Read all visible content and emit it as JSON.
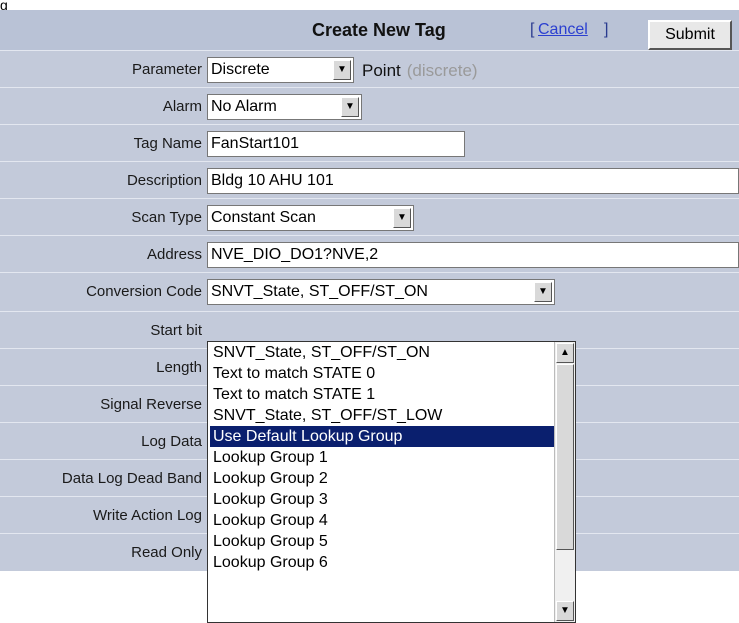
{
  "page_fragment": "g",
  "header": {
    "title": "Create New Tag",
    "cancel_open": "[",
    "cancel_label": "Cancel",
    "cancel_close": "]",
    "submit_label": "Submit"
  },
  "rows": {
    "parameter": {
      "label": "Parameter",
      "value": "Discrete",
      "point_label": "Point",
      "point_sub": "(discrete)"
    },
    "alarm": {
      "label": "Alarm",
      "value": "No Alarm"
    },
    "tag_name": {
      "label": "Tag Name",
      "value": "FanStart101"
    },
    "description": {
      "label": "Description",
      "value": "Bldg 10 AHU 101"
    },
    "scan_type": {
      "label": "Scan Type",
      "value": "Constant Scan"
    },
    "address": {
      "label": "Address",
      "value": "NVE_DIO_DO1?NVE,2"
    },
    "conversion_code": {
      "label": "Conversion Code",
      "value": "SNVT_State, ST_OFF/ST_ON"
    },
    "start_bit": {
      "label": "Start bit"
    },
    "length": {
      "label": "Length"
    },
    "signal_reverse": {
      "label": "Signal Reverse"
    },
    "log_data": {
      "label": "Log Data"
    },
    "data_log_dead_band": {
      "label": "Data Log Dead Band"
    },
    "write_action_log": {
      "label": "Write Action Log"
    },
    "read_only": {
      "label": "Read Only"
    }
  },
  "dropdown": {
    "options": [
      "SNVT_State, ST_OFF/ST_ON",
      "Text to match STATE 0",
      "Text to match STATE 1",
      "SNVT_State, ST_OFF/ST_LOW",
      "Use Default Lookup Group",
      "Lookup Group 1",
      "Lookup Group 2",
      "Lookup Group 3",
      "Lookup Group 4",
      "Lookup Group 5",
      "Lookup Group 6"
    ],
    "selected_index": 4
  },
  "icons": {
    "select_arrow": "chevron-down-icon",
    "scroll_up": "scroll-up-arrow-icon",
    "scroll_down": "scroll-down-arrow-icon"
  },
  "colors": {
    "header_bg": "#b9c2d6",
    "row_bg": "#c3cada",
    "selected_bg": "#0a1f6e",
    "link": "#2b3fd0"
  }
}
